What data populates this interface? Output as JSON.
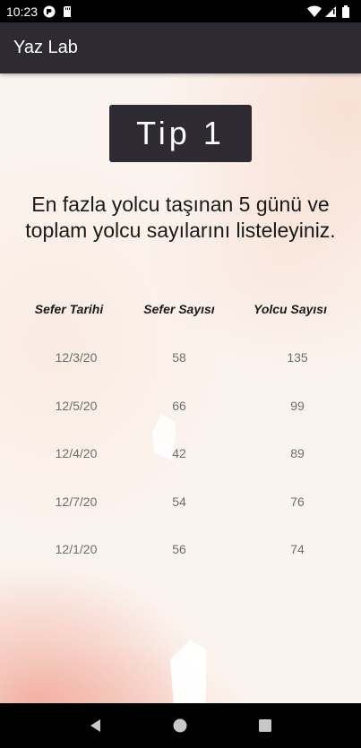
{
  "status_bar": {
    "time": "10:23",
    "icons_left": [
      "app-notification-icon",
      "sd-card-icon"
    ],
    "icons_right": [
      "wifi-icon",
      "signal-icon",
      "battery-icon"
    ]
  },
  "app_bar": {
    "title": "Yaz Lab"
  },
  "main": {
    "tip_label": "Tip 1",
    "question": "En fazla yolcu taşınan 5 günü ve toplam yolcu sayılarını listeleyiniz.",
    "table": {
      "headers": [
        "Sefer Tarihi",
        "Sefer Sayısı",
        "Yolcu Sayısı"
      ],
      "rows": [
        [
          "12/3/20",
          "58",
          "135"
        ],
        [
          "12/5/20",
          "66",
          "99"
        ],
        [
          "12/4/20",
          "42",
          "89"
        ],
        [
          "12/7/20",
          "54",
          "76"
        ],
        [
          "12/1/20",
          "56",
          "74"
        ]
      ]
    }
  },
  "nav_bar": {
    "buttons": [
      "back-icon",
      "home-icon",
      "recents-icon"
    ]
  },
  "colors": {
    "app_bar": "#2d2b31",
    "tip_box": "#2d2b31",
    "body_text": "#1a1a1a",
    "cell_text": "#6e6e6e"
  }
}
